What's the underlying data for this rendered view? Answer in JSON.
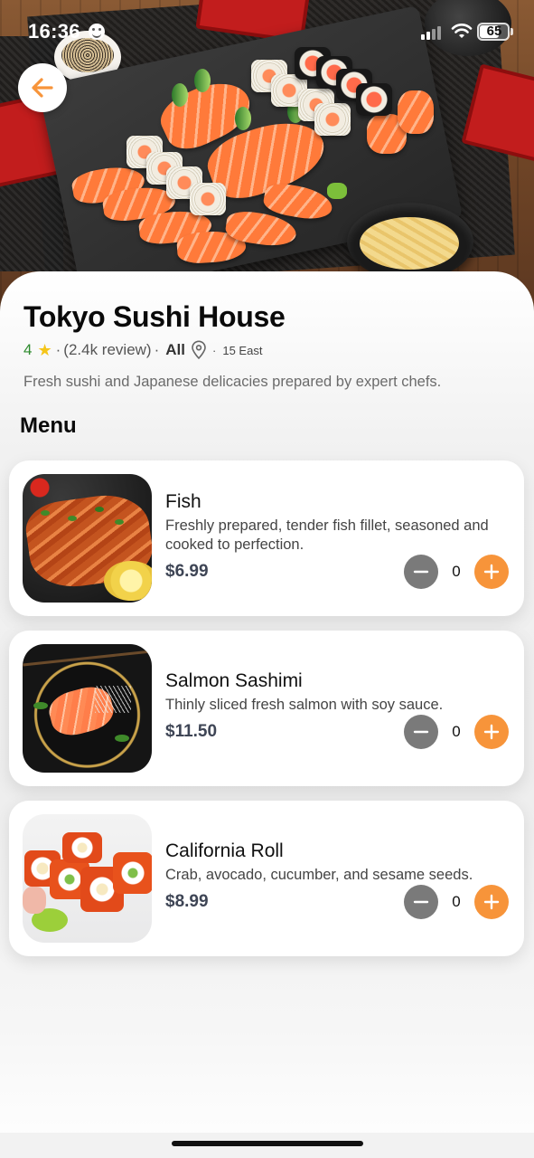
{
  "status_bar": {
    "time": "16:36",
    "battery": "65"
  },
  "restaurant": {
    "name": "Tokyo Sushi House",
    "rating": "4",
    "reviews": "(2.4k review)",
    "category": "All",
    "location": "15 East",
    "description": "Fresh sushi and Japanese delicacies prepared by expert chefs."
  },
  "menu": {
    "title": "Menu",
    "items": [
      {
        "name": "Fish",
        "description": "Freshly prepared, tender fish fillet, seasoned and cooked to perfection.",
        "price": "$6.99",
        "quantity": "0"
      },
      {
        "name": "Salmon Sashimi",
        "description": "Thinly sliced fresh salmon with soy sauce.",
        "price": "$11.50",
        "quantity": "0"
      },
      {
        "name": "California Roll",
        "description": "Crab, avocado, cucumber, and sesame seeds.",
        "price": "$8.99",
        "quantity": "0"
      }
    ]
  },
  "colors": {
    "accent": "#f7943a",
    "minus": "#7a7a7a",
    "rating": "#2e8b2e",
    "star": "#f5c518",
    "price": "#3e4555"
  },
  "icons": [
    "arrow-left-icon",
    "star-icon",
    "location-pin-icon",
    "minus-icon",
    "plus-icon",
    "wifi-icon",
    "signal-icon",
    "battery-icon"
  ]
}
